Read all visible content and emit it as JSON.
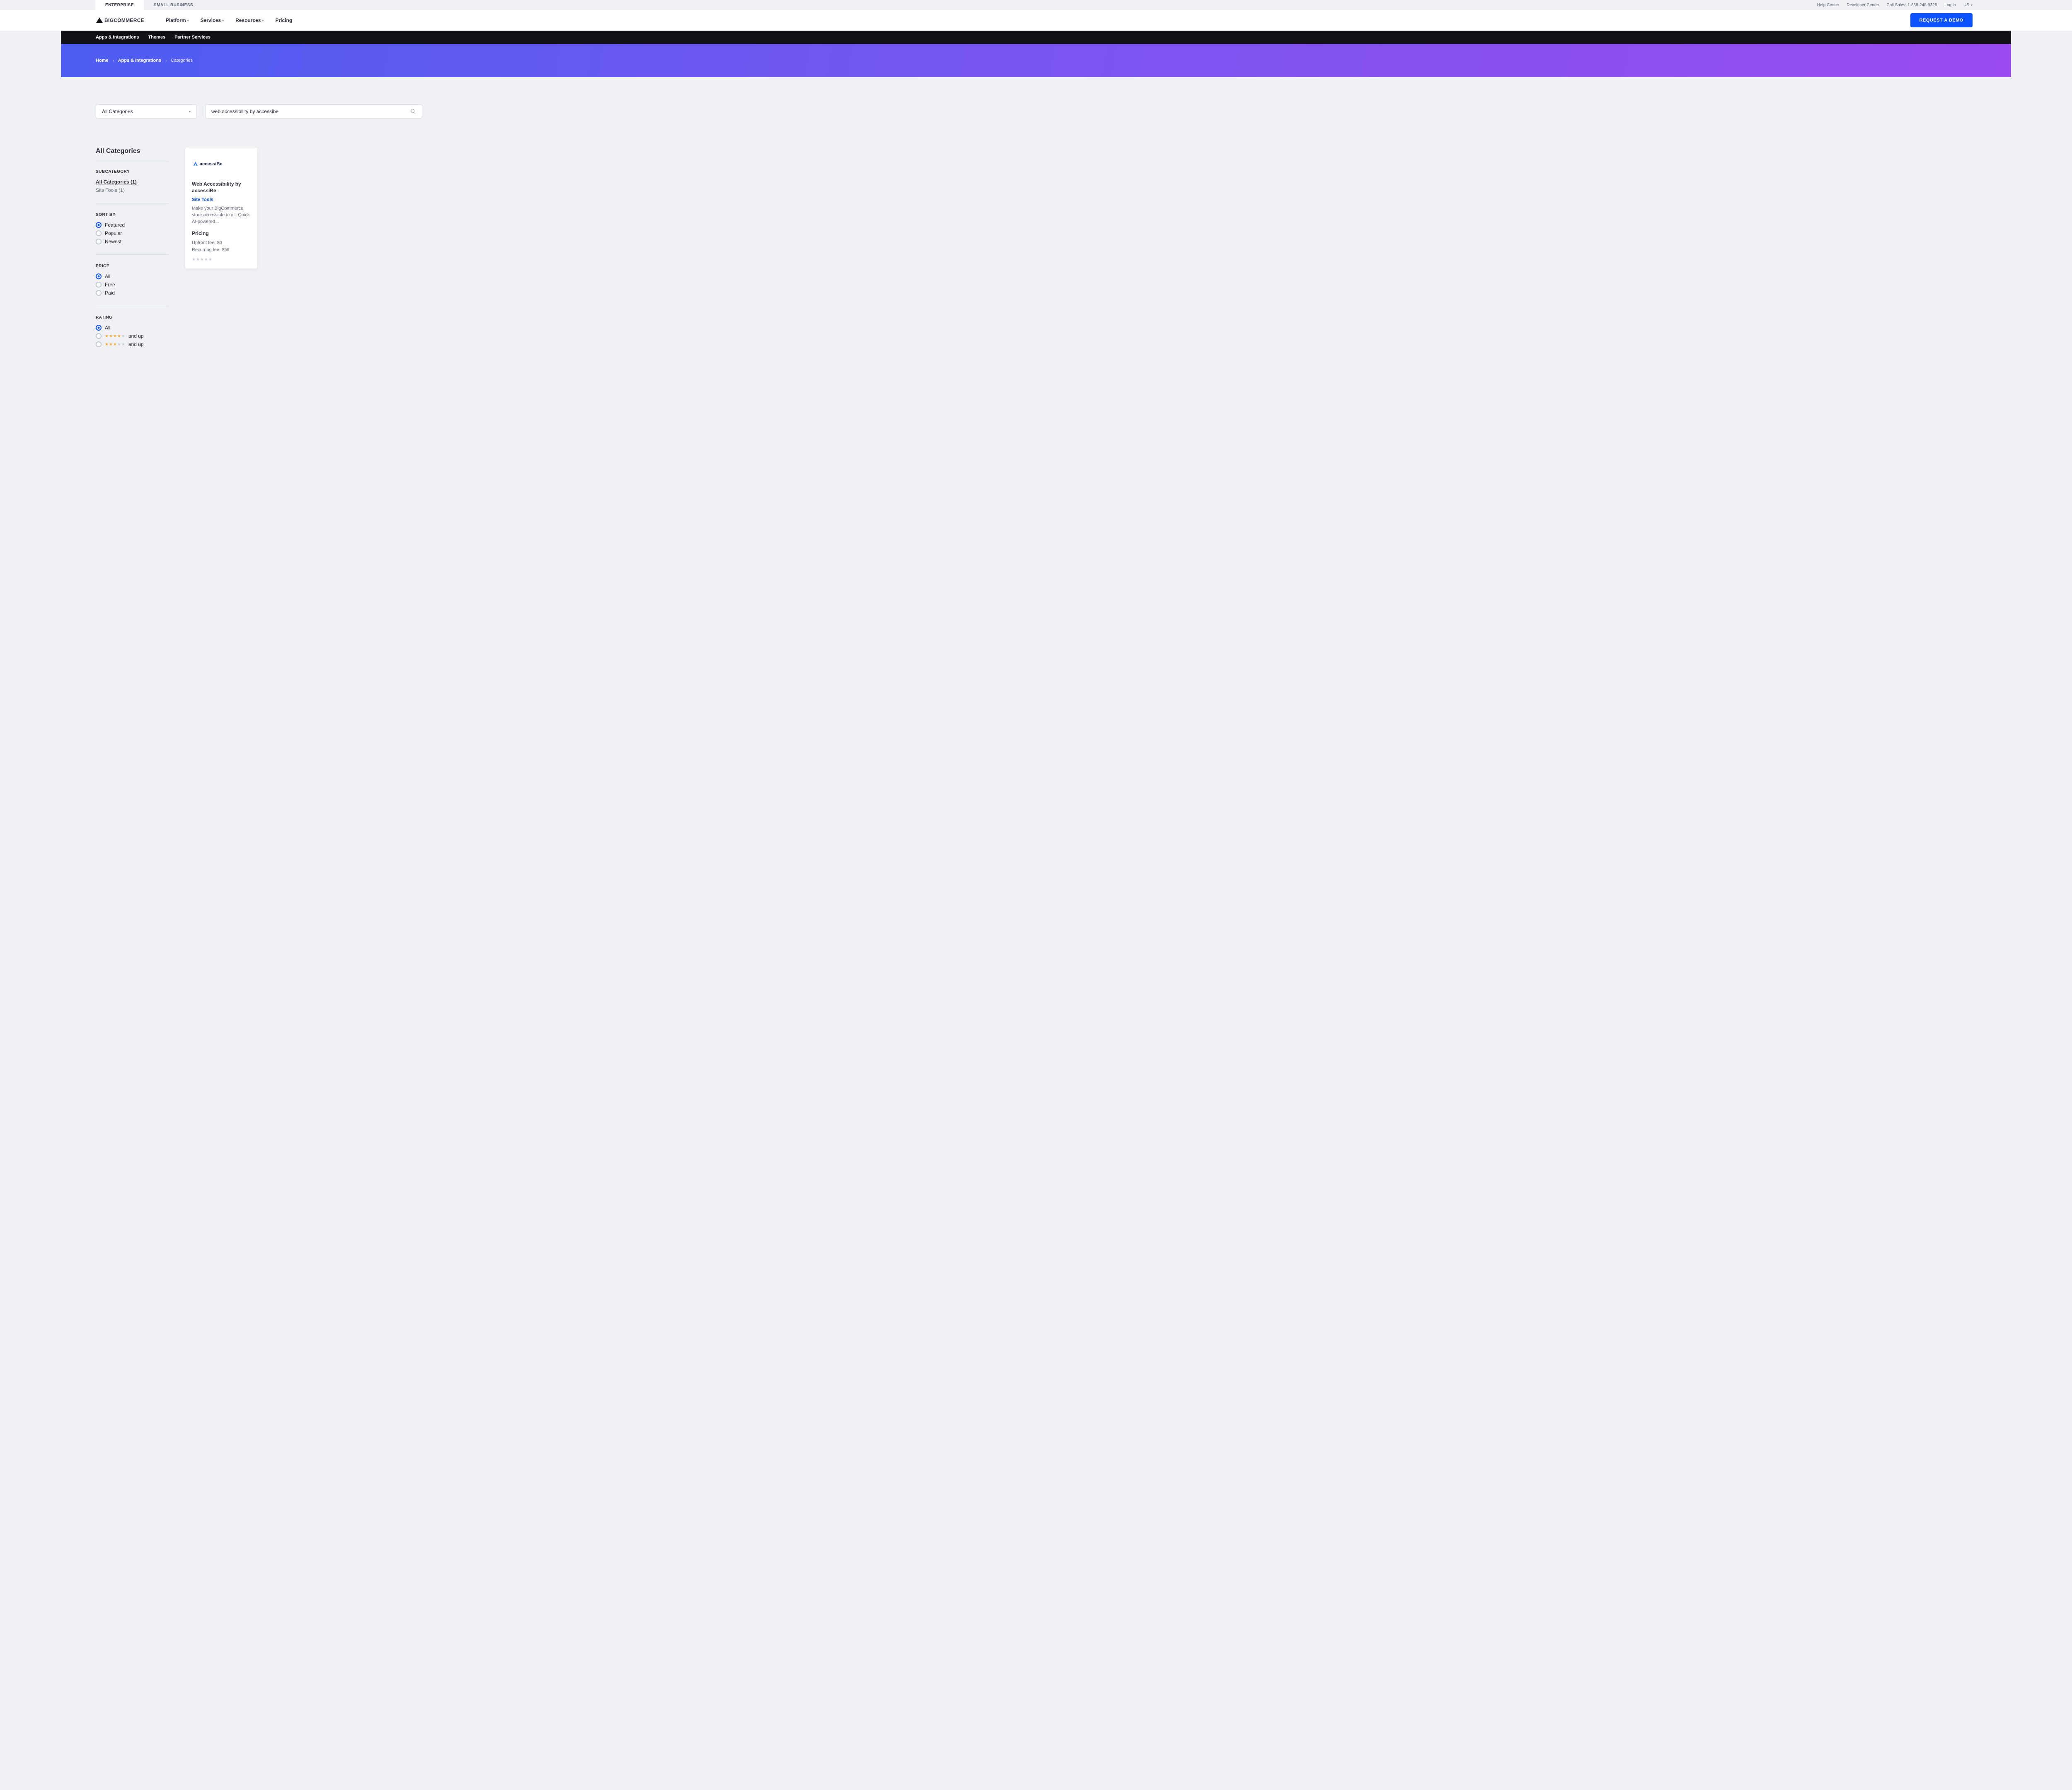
{
  "topbar": {
    "tabs": [
      {
        "label": "ENTERPRISE",
        "active": true
      },
      {
        "label": "SMALL BUSINESS",
        "active": false
      }
    ],
    "links": {
      "help": "Help Center",
      "dev": "Developer Center",
      "sales": "Call Sales: 1-888-248-9325",
      "login": "Log In"
    },
    "locale": "US"
  },
  "header": {
    "logo_text": "BIGCOMMERCE",
    "nav": {
      "platform": "Platform",
      "services": "Services",
      "resources": "Resources",
      "pricing": "Pricing"
    },
    "cta": "REQUEST A DEMO"
  },
  "subnav": {
    "apps": "Apps & Integrations",
    "themes": "Themes",
    "partner": "Partner Services"
  },
  "breadcrumb": {
    "home": "Home",
    "apps": "Apps & Integrations",
    "current": "Categories"
  },
  "search": {
    "category_selected": "All Categories",
    "query": "web accessibility by accessibe"
  },
  "sidebar": {
    "title": "All Categories",
    "subcategory_label": "SUBCATEGORY",
    "subcategories": [
      {
        "label": "All Categories (1)",
        "active": true
      },
      {
        "label": "Site Tools (1)",
        "active": false
      }
    ],
    "sort_label": "SORT BY",
    "sort_options": [
      {
        "label": "Featured",
        "checked": true
      },
      {
        "label": "Popular",
        "checked": false
      },
      {
        "label": "Newest",
        "checked": false
      }
    ],
    "price_label": "PRICE",
    "price_options": [
      {
        "label": "All",
        "checked": true
      },
      {
        "label": "Free",
        "checked": false
      },
      {
        "label": "Paid",
        "checked": false
      }
    ],
    "rating_label": "RATING",
    "rating_all": "All",
    "rating_suffix": "and up"
  },
  "card": {
    "logo_text": "accessiBe",
    "title": "Web Accessibility by accessiBe",
    "category": "Site Tools",
    "description": "Make your BigCommerce store accessible to all: Quick AI-powered...",
    "pricing_heading": "Pricing",
    "upfront": "Upfront fee: $0",
    "recurring": "Recurring fee: $59"
  }
}
